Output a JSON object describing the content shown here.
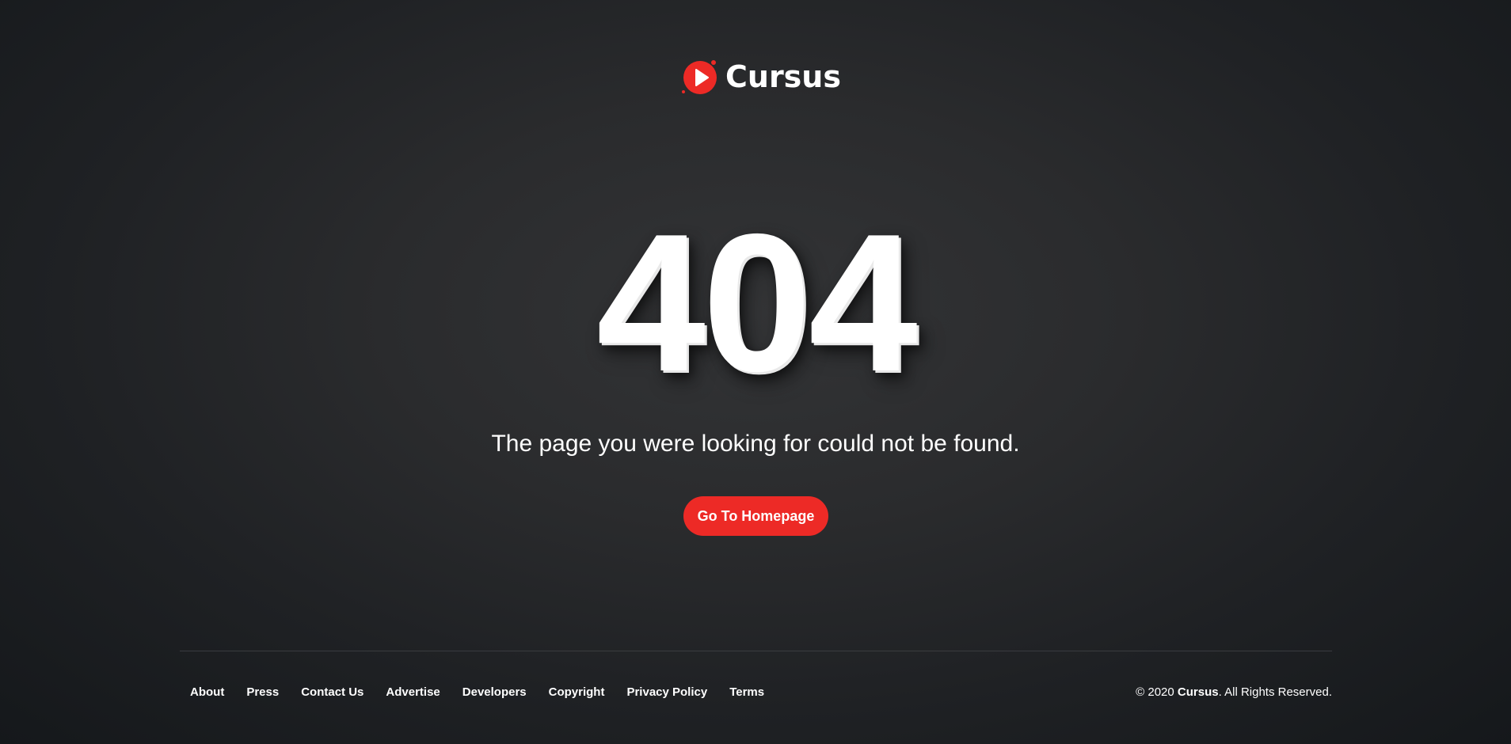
{
  "brand": {
    "name": "Cursus",
    "logo_icon": "play-icon",
    "accent_color": "#ed2a26"
  },
  "error": {
    "code": "404",
    "message": "The page you were looking for could not be found."
  },
  "actions": {
    "home_label": "Go To Homepage"
  },
  "footer": {
    "links": [
      {
        "label": "About"
      },
      {
        "label": "Press"
      },
      {
        "label": "Contact Us"
      },
      {
        "label": "Advertise"
      },
      {
        "label": "Developers"
      },
      {
        "label": "Copyright"
      },
      {
        "label": "Privacy Policy"
      },
      {
        "label": "Terms"
      }
    ],
    "copyright": {
      "prefix": "© 2020 ",
      "brand": "Cursus",
      "suffix": ". All Rights Reserved."
    }
  }
}
